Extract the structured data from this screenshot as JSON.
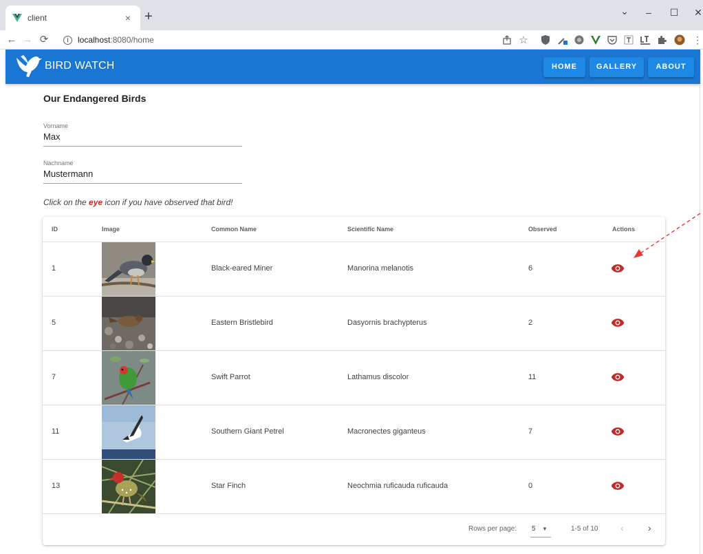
{
  "browser": {
    "tab_title": "client",
    "tab_close": "×",
    "new_tab": "+",
    "url_host": "localhost",
    "url_rest": ":8080/home",
    "minimize": "–",
    "maximize": "☐",
    "close": "✕",
    "chevron": "⌄"
  },
  "app": {
    "title": "BIRD WATCH",
    "nav": [
      {
        "label": "HOME"
      },
      {
        "label": "GALLERY"
      },
      {
        "label": "ABOUT"
      }
    ],
    "bar_color": "#1976d2"
  },
  "main": {
    "heading": "Our Endangered Birds",
    "first_name": {
      "label": "Vorname",
      "value": "Max"
    },
    "last_name": {
      "label": "Nachname",
      "value": "Mustermann"
    },
    "hint": {
      "before": "Click on the ",
      "highlight": "eye",
      "after": " icon if you have observed that bird!"
    }
  },
  "table": {
    "headers": {
      "id": "ID",
      "image": "Image",
      "common_name": "Common Name",
      "scientific_name": "Scientific Name",
      "observed": "Observed",
      "actions": "Actions"
    },
    "rows": [
      {
        "id": "1",
        "common_name": "Black-eared Miner",
        "scientific_name": "Manorina melanotis",
        "observed": "6"
      },
      {
        "id": "5",
        "common_name": "Eastern Bristlebird",
        "scientific_name": "Dasyornis brachypterus",
        "observed": "2"
      },
      {
        "id": "7",
        "common_name": "Swift Parrot",
        "scientific_name": "Lathamus discolor",
        "observed": "11"
      },
      {
        "id": "11",
        "common_name": "Southern Giant Petrel",
        "scientific_name": "Macronectes giganteus",
        "observed": "7"
      },
      {
        "id": "13",
        "common_name": "Star Finch",
        "scientific_name": "Neochmia ruficauda ruficauda",
        "observed": "0"
      }
    ],
    "footer": {
      "rows_per_page_label": "Rows per page:",
      "rows_per_page_value": "5",
      "range": "1-5 of 10",
      "prev": "‹",
      "next": "›"
    },
    "eye_color": "#c62828"
  }
}
